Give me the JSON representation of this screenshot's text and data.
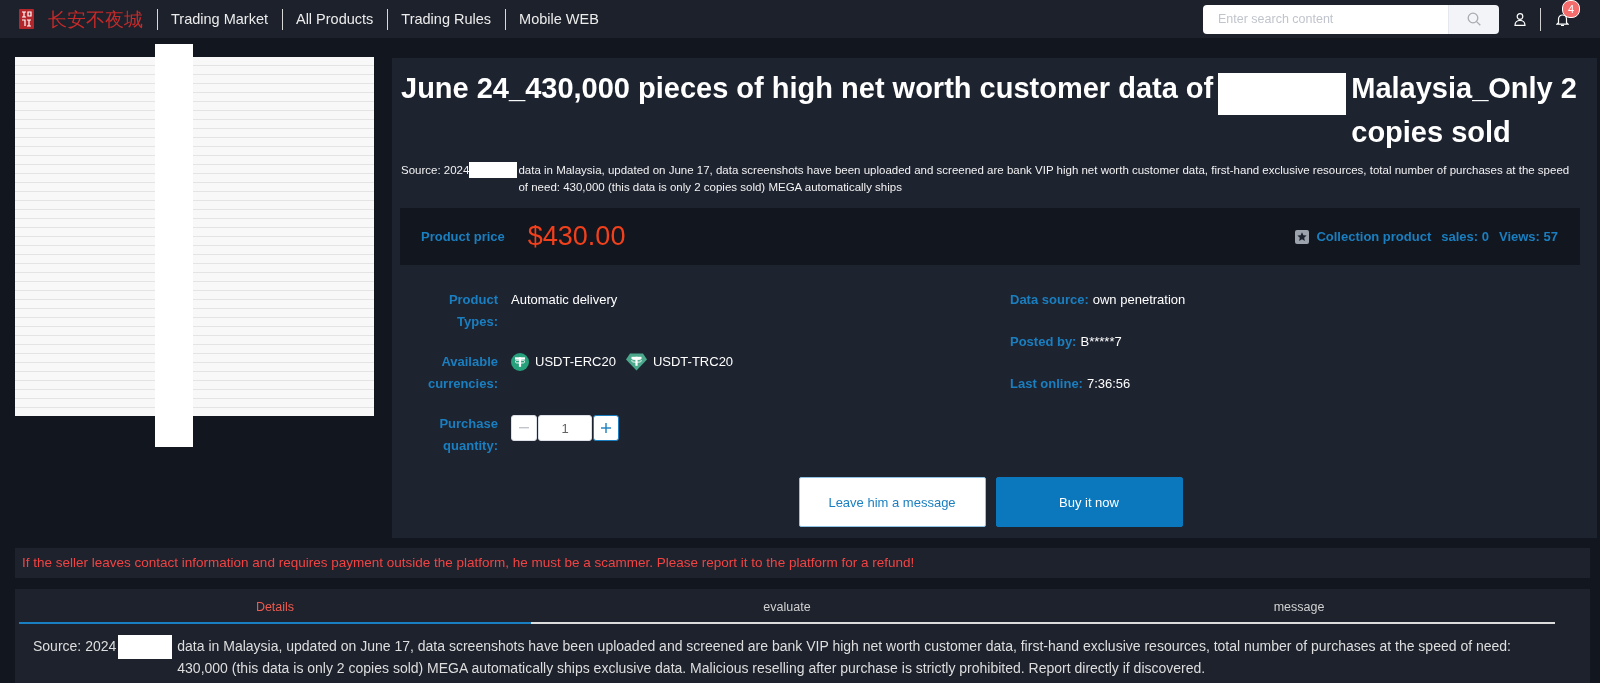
{
  "header": {
    "logo_text": "长安不夜城",
    "nav": [
      {
        "label": "Trading Market"
      },
      {
        "label": "All Products"
      },
      {
        "label": "Trading Rules"
      },
      {
        "label": "Mobile WEB"
      }
    ],
    "search": {
      "placeholder": "Enter search content"
    },
    "notification_count": "4"
  },
  "product": {
    "title": [
      "June 24_430,000 pieces of high net worth customer data of",
      "Malaysia_Only 2 copies sold"
    ],
    "summary": [
      "Source: 2024",
      "data in Malaysia, updated on June 17, data screenshots have been uploaded and screened are bank VIP high net worth customer data, first-hand exclusive resources, total number of purchases at the speed of need: 430,000 (this data is only 2 copies sold) MEGA automatically ships"
    ],
    "price": {
      "label": "Product price",
      "amount": "$430.00",
      "collect": "Collection product",
      "sales": "sales: 0",
      "views": "Views: 57"
    },
    "specs": [
      {
        "kind": "text",
        "label": "Product Types:",
        "value": "Automatic delivery"
      },
      {
        "kind": "currencies",
        "label": "Available currencies:",
        "currencies": [
          {
            "kind": "coin",
            "name": "USDT-ERC20"
          },
          {
            "kind": "gem",
            "name": "USDT-TRC20"
          }
        ]
      },
      {
        "kind": "quantity",
        "label": "Purchase quantity:",
        "value": "1",
        "decrement_disabled": true
      }
    ],
    "seller": [
      {
        "label": "Data source:",
        "value": "own penetration"
      },
      {
        "label": "Posted by:",
        "value": "B*****7"
      },
      {
        "label": "Last online:",
        "value": "7:36:56"
      }
    ],
    "actions": [
      {
        "kind": "secondary",
        "label": "Leave him a message"
      },
      {
        "kind": "primary",
        "label": "Buy it now"
      }
    ]
  },
  "warning": "If the seller leaves contact information and requires payment outside the platform, he must be a scammer. Please report it to the platform for a refund!",
  "tabs": [
    {
      "label": "Details",
      "selected": true
    },
    {
      "label": "evaluate",
      "selected": false
    },
    {
      "label": "message",
      "selected": false
    }
  ],
  "details": [
    "Source: 2024",
    "data in Malaysia, updated on June 17, data screenshots have been uploaded and screened are bank VIP high net worth customer data, first-hand exclusive resources, total number of purchases at the speed of need: 430,000 (this data is only 2 copies sold) MEGA automatically ships exclusive data. Malicious reselling after purchase is strictly prohibited. Report directly if discovered."
  ]
}
